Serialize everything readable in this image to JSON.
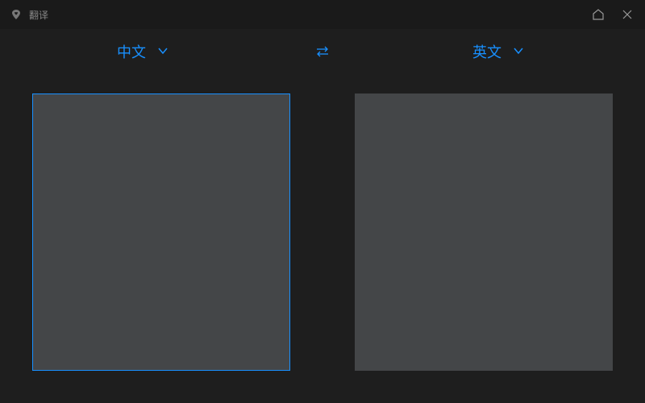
{
  "titlebar": {
    "title": "翻译"
  },
  "languages": {
    "source": "中文",
    "target": "英文"
  }
}
